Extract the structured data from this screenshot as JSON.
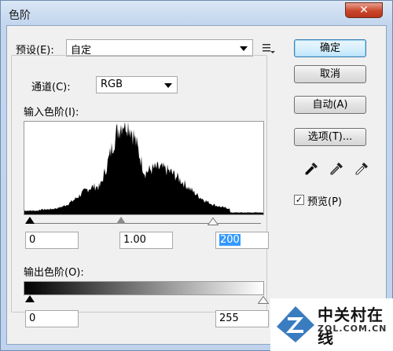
{
  "window": {
    "title": "色阶"
  },
  "preset": {
    "label": "预设(E):",
    "value": "自定"
  },
  "buttons": {
    "ok": "确定",
    "cancel": "取消",
    "auto": "自动(A)",
    "options": "选项(T)..."
  },
  "channel": {
    "label": "通道(C):",
    "value": "RGB"
  },
  "input_levels": {
    "label": "输入色阶(I):",
    "shadow": "0",
    "midtone": "1.00",
    "highlight": "200"
  },
  "output_levels": {
    "label": "输出色阶(O):",
    "shadow": "0",
    "highlight": "255"
  },
  "preview": {
    "label": "预览(P)",
    "checked": true
  },
  "watermark": {
    "cn": "中关村在线",
    "en": "ZOL.COM.CN"
  }
}
